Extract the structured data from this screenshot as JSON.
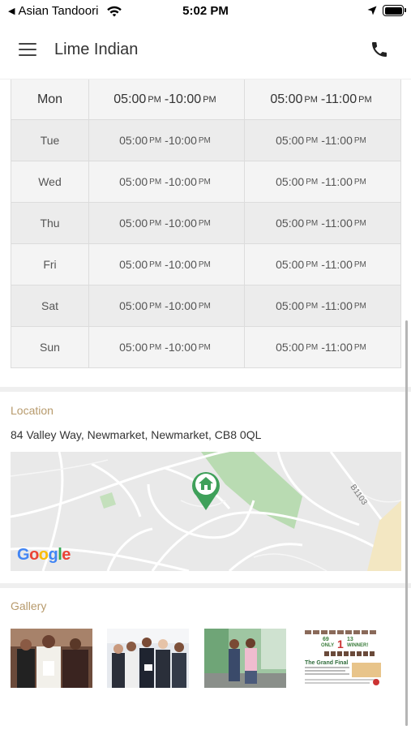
{
  "status_bar": {
    "back_app": "Asian Tandoori",
    "time": "5:02 PM"
  },
  "header": {
    "title": "Lime Indian"
  },
  "hours": {
    "rows": [
      {
        "day": "Mon",
        "s1_open": "05:00",
        "s1_open_ampm": "PM",
        "s1_close": "10:00",
        "s1_close_ampm": "PM",
        "s2_open": "05:00",
        "s2_open_ampm": "PM",
        "s2_close": "11:00",
        "s2_close_ampm": "PM"
      },
      {
        "day": "Tue",
        "s1_open": "05:00",
        "s1_open_ampm": "PM",
        "s1_close": "10:00",
        "s1_close_ampm": "PM",
        "s2_open": "05:00",
        "s2_open_ampm": "PM",
        "s2_close": "11:00",
        "s2_close_ampm": "PM"
      },
      {
        "day": "Wed",
        "s1_open": "05:00",
        "s1_open_ampm": "PM",
        "s1_close": "10:00",
        "s1_close_ampm": "PM",
        "s2_open": "05:00",
        "s2_open_ampm": "PM",
        "s2_close": "11:00",
        "s2_close_ampm": "PM"
      },
      {
        "day": "Thu",
        "s1_open": "05:00",
        "s1_open_ampm": "PM",
        "s1_close": "10:00",
        "s1_close_ampm": "PM",
        "s2_open": "05:00",
        "s2_open_ampm": "PM",
        "s2_close": "11:00",
        "s2_close_ampm": "PM"
      },
      {
        "day": "Fri",
        "s1_open": "05:00",
        "s1_open_ampm": "PM",
        "s1_close": "10:00",
        "s1_close_ampm": "PM",
        "s2_open": "05:00",
        "s2_open_ampm": "PM",
        "s2_close": "11:00",
        "s2_close_ampm": "PM"
      },
      {
        "day": "Sat",
        "s1_open": "05:00",
        "s1_open_ampm": "PM",
        "s1_close": "10:00",
        "s1_close_ampm": "PM",
        "s2_open": "05:00",
        "s2_open_ampm": "PM",
        "s2_close": "11:00",
        "s2_close_ampm": "PM"
      },
      {
        "day": "Sun",
        "s1_open": "05:00",
        "s1_open_ampm": "PM",
        "s1_close": "10:00",
        "s1_close_ampm": "PM",
        "s2_open": "05:00",
        "s2_open_ampm": "PM",
        "s2_close": "11:00",
        "s2_close_ampm": "PM"
      }
    ]
  },
  "location": {
    "label": "Location",
    "address": "84 Valley Way, Newmarket, Newmarket, CB8 0QL",
    "map_road_label": "B1103",
    "map_brand": "Google",
    "marker_color": "#3fa05a"
  },
  "gallery": {
    "label": "Gallery",
    "poster_text": {
      "line1": "69",
      "line2": "ONLY",
      "number": "1",
      "line3": "13",
      "winner": "WINNER!",
      "headline": "The Grand Final"
    }
  },
  "colors": {
    "section_label": "#b79a6c",
    "accent_green": "#3fa05a"
  }
}
